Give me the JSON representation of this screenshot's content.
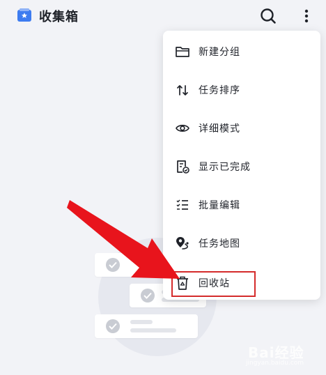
{
  "header": {
    "title": "收集箱",
    "app_icon": "inbox-star-icon",
    "search_icon": "search-icon",
    "more_icon": "more-vertical-icon"
  },
  "menu": {
    "items": [
      {
        "label": "新建分组",
        "icon": "folder-icon"
      },
      {
        "label": "任务排序",
        "icon": "sort-arrows-icon"
      },
      {
        "label": "详细模式",
        "icon": "eye-icon"
      },
      {
        "label": "显示已完成",
        "icon": "completed-doc-icon"
      },
      {
        "label": "批量编辑",
        "icon": "checklist-icon"
      },
      {
        "label": "任务地图",
        "icon": "map-pin-icon"
      },
      {
        "label": "回收站",
        "icon": "trash-icon"
      }
    ]
  },
  "watermark": {
    "text": "Bai经验",
    "sub": "jingyan.baidu.com"
  },
  "colors": {
    "accent": "#3d7cf0",
    "annotation_red": "#e8141c",
    "highlight_border": "#d42b2b",
    "background": "#f2f3f7"
  }
}
